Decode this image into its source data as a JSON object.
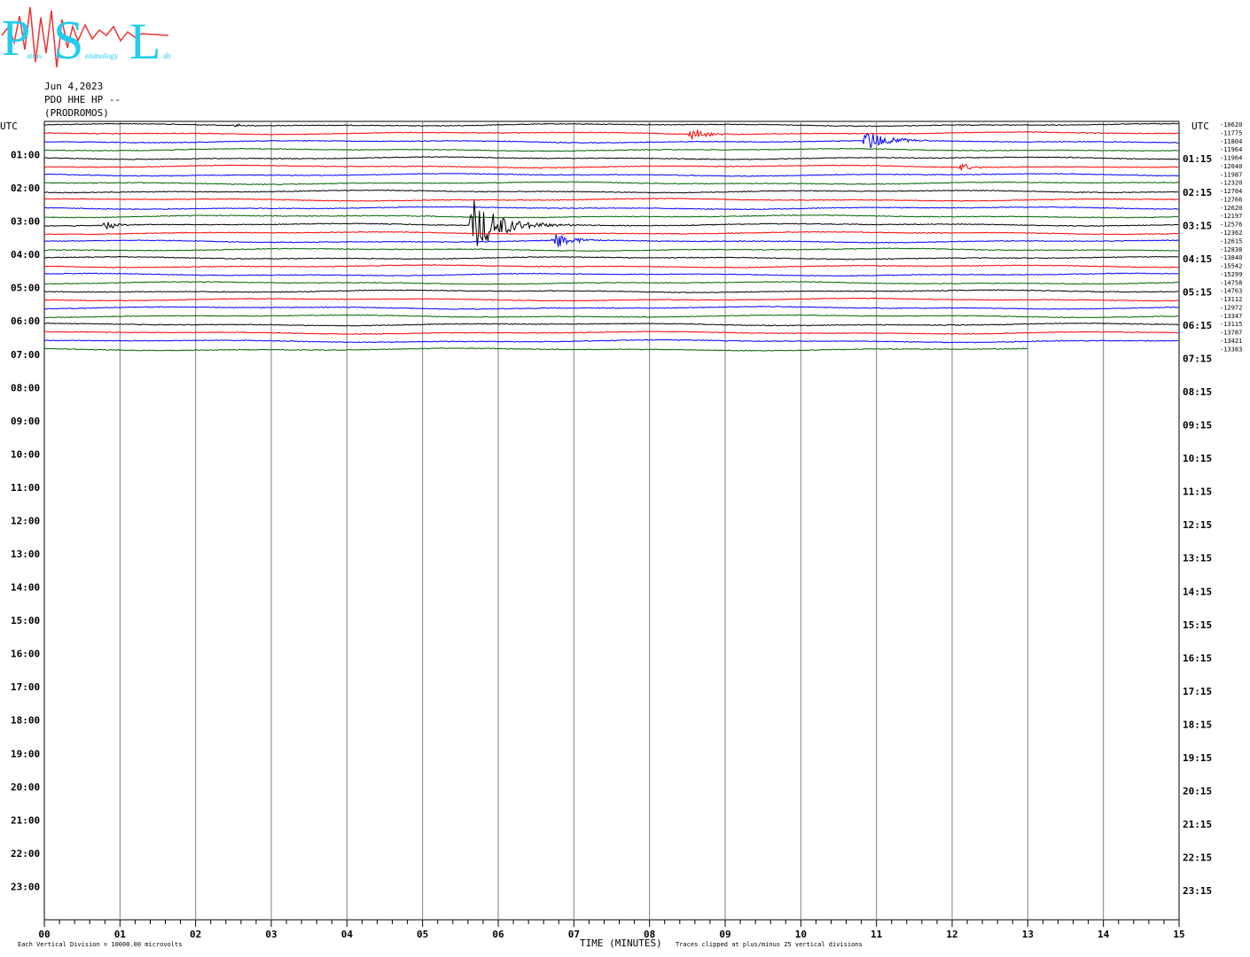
{
  "header": {
    "date": "Jun 4,2023",
    "station": "PDO HHE HP --",
    "location": "(PRODROMOS)"
  },
  "logo": {
    "letters": [
      "P",
      "S",
      "L"
    ],
    "words": [
      "atras",
      "eismology",
      "ab"
    ],
    "color_text": "#22ccee",
    "color_wave": "#ee3333"
  },
  "chart_data": {
    "type": "line",
    "title": "",
    "left_axis_title": "UTC",
    "right_axis_title": "UTC",
    "left_hour_labels": [
      "01:00",
      "02:00",
      "03:00",
      "04:00",
      "05:00",
      "06:00",
      "07:00",
      "08:00",
      "09:00",
      "10:00",
      "11:00",
      "12:00",
      "13:00",
      "14:00",
      "15:00",
      "16:00",
      "17:00",
      "18:00",
      "19:00",
      "20:00",
      "21:00",
      "22:00",
      "23:00"
    ],
    "right_hour_labels": [
      "01:15",
      "02:15",
      "03:15",
      "04:15",
      "05:15",
      "06:15",
      "07:15",
      "08:15",
      "09:15",
      "10:15",
      "11:15",
      "12:15",
      "13:15",
      "14:15",
      "15:15",
      "16:15",
      "17:15",
      "18:15",
      "19:15",
      "20:15",
      "21:15",
      "22:15",
      "23:15"
    ],
    "x_ticks": [
      "00",
      "01",
      "02",
      "03",
      "04",
      "05",
      "06",
      "07",
      "08",
      "09",
      "10",
      "11",
      "12",
      "13",
      "14",
      "15"
    ],
    "xlabel": "TIME (MINUTES)",
    "xlim": [
      0,
      15
    ],
    "rows_per_hour": 4,
    "total_rows": 96,
    "trace_colors": [
      "#000000",
      "#ff0000",
      "#0000ff",
      "#006400"
    ],
    "row_offsets": [
      "-10620",
      "-11775",
      "-11804",
      "-11964",
      "-11964",
      "-12040",
      "-11987",
      "-12320",
      "-12704",
      "-12766",
      "-12620",
      "-12197",
      "-12576",
      "-12362",
      "-12615",
      "-12838",
      "-13840",
      "-15542",
      "-15299",
      "-14758",
      "-14763",
      "-13112",
      "-12972",
      "-13347",
      "-13115",
      "-13787",
      "-13421",
      "-13383"
    ],
    "last_row_end_minute": 13,
    "events": [
      {
        "row": 0,
        "minute": 2.5,
        "amplitude": 3,
        "duration": 0.3
      },
      {
        "row": 1,
        "minute": 8.55,
        "amplitude": 8,
        "duration": 0.7
      },
      {
        "row": 2,
        "minute": 10.85,
        "amplitude": 12,
        "duration": 1.0
      },
      {
        "row": 5,
        "minute": 12.1,
        "amplitude": 5,
        "duration": 0.5
      },
      {
        "row": 12,
        "minute": 0.8,
        "amplitude": 5,
        "duration": 0.5
      },
      {
        "row": 12,
        "minute": 5.65,
        "amplitude": 30,
        "duration": 1.4
      },
      {
        "row": 14,
        "minute": 6.75,
        "amplitude": 10,
        "duration": 0.8
      }
    ],
    "footer_left": "Each Vertical Division = 10000.00 microvolts",
    "footer_right": "Traces clipped at plus/minus 25 vertical divisions",
    "grid": true
  }
}
